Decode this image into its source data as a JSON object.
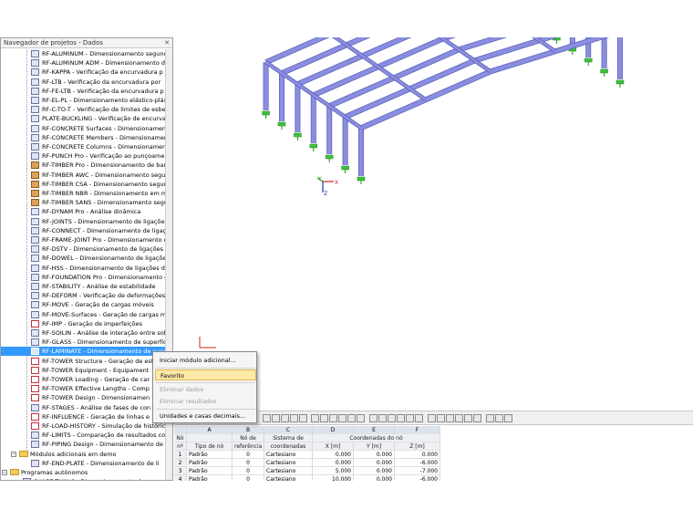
{
  "navigator": {
    "title": "Navegador de projetos - Dados",
    "controls": "✕",
    "items": [
      {
        "label": "RF-ALUMINUM - Dimensionamento segund",
        "kind": "normal"
      },
      {
        "label": "RF-ALUMINUM ADM - Dimensionamento d",
        "kind": "normal"
      },
      {
        "label": "RF-KAPPA - Verificação da encurvadura p",
        "kind": "normal"
      },
      {
        "label": "RF-LTB - Verificação da encurvadura por",
        "kind": "normal"
      },
      {
        "label": "RF-FE-LTB - Verificação da encurvadura p",
        "kind": "normal"
      },
      {
        "label": "RF-EL-PL - Dimensionamento elástico-plást",
        "kind": "normal"
      },
      {
        "label": "RF-C-TO-T - Verificação de limites de esbelt",
        "kind": "normal"
      },
      {
        "label": "PLATE-BUCKLING - Verificação de encurvad",
        "kind": "normal"
      },
      {
        "label": "RF-CONCRETE Surfaces - Dimensionamento",
        "kind": "normal"
      },
      {
        "label": "RF-CONCRETE Members - Dimensionament",
        "kind": "normal"
      },
      {
        "label": "RF-CONCRETE Columns - Dimensionament",
        "kind": "normal"
      },
      {
        "label": "RF-PUNCH Pro - Verificação ao punçoamen",
        "kind": "normal"
      },
      {
        "label": "RF-TIMBER Pro - Dimensionamento de barr",
        "kind": "timber"
      },
      {
        "label": "RF-TIMBER AWC - Dimensionamento segun",
        "kind": "timber"
      },
      {
        "label": "RF-TIMBER CSA - Dimensionamento segun",
        "kind": "timber"
      },
      {
        "label": "RF-TIMBER NBR - Dimensionamento em ma",
        "kind": "timber"
      },
      {
        "label": "RF-TIMBER SANS - Dimensionamento segur",
        "kind": "timber"
      },
      {
        "label": "RF-DYNAM Pro - Análise dinâmica",
        "kind": "normal"
      },
      {
        "label": "RF-JOINTS - Dimensionamento de ligações",
        "kind": "normal"
      },
      {
        "label": "RF-CONNECT - Dimensionamento de ligaç",
        "kind": "normal"
      },
      {
        "label": "RF-FRAME-JOINT Pro - Dimensionamento d",
        "kind": "normal"
      },
      {
        "label": "RF-DSTV - Dimensionamento de ligações pa",
        "kind": "normal"
      },
      {
        "label": "RF-DOWEL - Dimensionamento de ligações",
        "kind": "normal"
      },
      {
        "label": "RF-HSS - Dimensionamento de ligações de s",
        "kind": "normal"
      },
      {
        "label": "RF-FOUNDATION Pro - Dimensionamento d",
        "kind": "normal"
      },
      {
        "label": "RF-STABILITY - Análise de estabilidade",
        "kind": "normal"
      },
      {
        "label": "RF-DEFORM - Verificação de deformações e",
        "kind": "normal"
      },
      {
        "label": "RF-MOVE - Geração de cargas móveis",
        "kind": "normal"
      },
      {
        "label": "RF-MOVE-Surfaces - Geração de cargas mó",
        "kind": "normal"
      },
      {
        "label": "RF-IMP - Geração de imperfeições",
        "kind": "special"
      },
      {
        "label": "RF-SOILIN - Análise de interação entre solo e",
        "kind": "normal"
      },
      {
        "label": "RF-GLASS - Dimensionamento de superfície",
        "kind": "normal"
      },
      {
        "label": "RF-LAMINATE - Dimensionamento de super",
        "kind": "selected"
      },
      {
        "label": "RF-TOWER Structure - Geração de est",
        "kind": "special"
      },
      {
        "label": "RF-TOWER Equipment - Equipament",
        "kind": "special"
      },
      {
        "label": "RF-TOWER Loading - Geração de car",
        "kind": "special"
      },
      {
        "label": "RF-TOWER Effective Lengths - Comp",
        "kind": "special"
      },
      {
        "label": "RF-TOWER Design - Dimensionamen",
        "kind": "special"
      },
      {
        "label": "RF-STAGES - Análise de fases de con",
        "kind": "normal"
      },
      {
        "label": "RF-INFLUENCE - Geração de linhas e",
        "kind": "special"
      },
      {
        "label": "RF-LOAD-HISTORY - Simulação de histórico",
        "kind": "special"
      },
      {
        "label": "RF-LIMITS - Comparação de resultados com",
        "kind": "normal"
      },
      {
        "label": "RF-PIPING Design - Dimensionamento de c",
        "kind": "normal"
      }
    ],
    "folder_demo": "Módulos adicionais em demo",
    "demo_item": "RF-END-PLATE - Dimensionamento de li",
    "folder_standalone": "Programas autónomos",
    "standalone_item": "SHAPE-THIN 9 - Dimensionamento de secç"
  },
  "context_menu": {
    "items": [
      {
        "label": "Iniciar módulo adicional...",
        "state": "normal"
      },
      {
        "label": "Favorito",
        "state": "highlighted"
      },
      {
        "label": "Eliminar dados",
        "state": "disabled"
      },
      {
        "label": "Eliminar resultados",
        "state": "disabled"
      },
      {
        "label": "Unidades e casas decimais...",
        "state": "normal"
      }
    ]
  },
  "axes": {
    "x": "X",
    "y": "Y",
    "z": "Z"
  },
  "table": {
    "letters": [
      "A",
      "B",
      "C",
      "D",
      "E",
      "F"
    ],
    "header_row1": [
      "Nó",
      "",
      "Nó de",
      "Sistema de",
      "Coordenadas do nó"
    ],
    "header_row2": [
      "nº",
      "Tipo de nó",
      "referência",
      "coordenadas",
      "X [m]",
      "Y [m]",
      "Z [m]"
    ],
    "rows": [
      [
        "1",
        "Padrão",
        "0",
        "Cartesiano",
        "0.000",
        "0.000",
        "0.000"
      ],
      [
        "2",
        "Padrão",
        "0",
        "Cartesiano",
        "0.000",
        "0.000",
        "-6.000"
      ],
      [
        "3",
        "Padrão",
        "0",
        "Cartesiano",
        "5.000",
        "0.000",
        "-7.000"
      ],
      [
        "4",
        "Padrão",
        "0",
        "Cartesiano",
        "10.000",
        "0.000",
        "-6.000"
      ]
    ]
  },
  "colors": {
    "steel": "#8a8ee0",
    "steel_dark": "#5c60b8",
    "support": "#3fbf3f",
    "selection": "#3399ff",
    "menu_highlight": "#fde9a8"
  }
}
